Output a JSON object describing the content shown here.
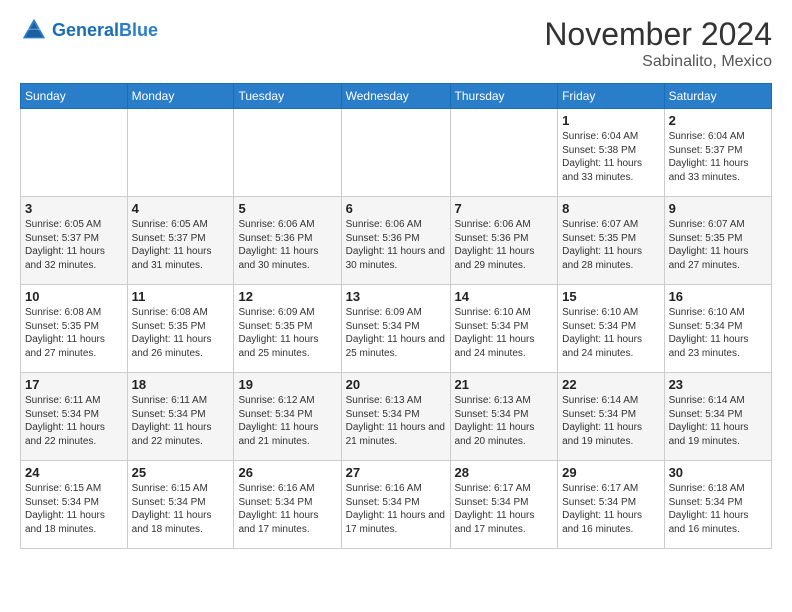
{
  "header": {
    "logo_general": "General",
    "logo_blue": "Blue",
    "title": "November 2024",
    "subtitle": "Sabinalito, Mexico"
  },
  "days_of_week": [
    "Sunday",
    "Monday",
    "Tuesday",
    "Wednesday",
    "Thursday",
    "Friday",
    "Saturday"
  ],
  "weeks": [
    [
      {
        "day": "",
        "info": ""
      },
      {
        "day": "",
        "info": ""
      },
      {
        "day": "",
        "info": ""
      },
      {
        "day": "",
        "info": ""
      },
      {
        "day": "",
        "info": ""
      },
      {
        "day": "1",
        "info": "Sunrise: 6:04 AM\nSunset: 5:38 PM\nDaylight: 11 hours and 33 minutes."
      },
      {
        "day": "2",
        "info": "Sunrise: 6:04 AM\nSunset: 5:37 PM\nDaylight: 11 hours and 33 minutes."
      }
    ],
    [
      {
        "day": "3",
        "info": "Sunrise: 6:05 AM\nSunset: 5:37 PM\nDaylight: 11 hours and 32 minutes."
      },
      {
        "day": "4",
        "info": "Sunrise: 6:05 AM\nSunset: 5:37 PM\nDaylight: 11 hours and 31 minutes."
      },
      {
        "day": "5",
        "info": "Sunrise: 6:06 AM\nSunset: 5:36 PM\nDaylight: 11 hours and 30 minutes."
      },
      {
        "day": "6",
        "info": "Sunrise: 6:06 AM\nSunset: 5:36 PM\nDaylight: 11 hours and 30 minutes."
      },
      {
        "day": "7",
        "info": "Sunrise: 6:06 AM\nSunset: 5:36 PM\nDaylight: 11 hours and 29 minutes."
      },
      {
        "day": "8",
        "info": "Sunrise: 6:07 AM\nSunset: 5:35 PM\nDaylight: 11 hours and 28 minutes."
      },
      {
        "day": "9",
        "info": "Sunrise: 6:07 AM\nSunset: 5:35 PM\nDaylight: 11 hours and 27 minutes."
      }
    ],
    [
      {
        "day": "10",
        "info": "Sunrise: 6:08 AM\nSunset: 5:35 PM\nDaylight: 11 hours and 27 minutes."
      },
      {
        "day": "11",
        "info": "Sunrise: 6:08 AM\nSunset: 5:35 PM\nDaylight: 11 hours and 26 minutes."
      },
      {
        "day": "12",
        "info": "Sunrise: 6:09 AM\nSunset: 5:35 PM\nDaylight: 11 hours and 25 minutes."
      },
      {
        "day": "13",
        "info": "Sunrise: 6:09 AM\nSunset: 5:34 PM\nDaylight: 11 hours and 25 minutes."
      },
      {
        "day": "14",
        "info": "Sunrise: 6:10 AM\nSunset: 5:34 PM\nDaylight: 11 hours and 24 minutes."
      },
      {
        "day": "15",
        "info": "Sunrise: 6:10 AM\nSunset: 5:34 PM\nDaylight: 11 hours and 24 minutes."
      },
      {
        "day": "16",
        "info": "Sunrise: 6:10 AM\nSunset: 5:34 PM\nDaylight: 11 hours and 23 minutes."
      }
    ],
    [
      {
        "day": "17",
        "info": "Sunrise: 6:11 AM\nSunset: 5:34 PM\nDaylight: 11 hours and 22 minutes."
      },
      {
        "day": "18",
        "info": "Sunrise: 6:11 AM\nSunset: 5:34 PM\nDaylight: 11 hours and 22 minutes."
      },
      {
        "day": "19",
        "info": "Sunrise: 6:12 AM\nSunset: 5:34 PM\nDaylight: 11 hours and 21 minutes."
      },
      {
        "day": "20",
        "info": "Sunrise: 6:13 AM\nSunset: 5:34 PM\nDaylight: 11 hours and 21 minutes."
      },
      {
        "day": "21",
        "info": "Sunrise: 6:13 AM\nSunset: 5:34 PM\nDaylight: 11 hours and 20 minutes."
      },
      {
        "day": "22",
        "info": "Sunrise: 6:14 AM\nSunset: 5:34 PM\nDaylight: 11 hours and 19 minutes."
      },
      {
        "day": "23",
        "info": "Sunrise: 6:14 AM\nSunset: 5:34 PM\nDaylight: 11 hours and 19 minutes."
      }
    ],
    [
      {
        "day": "24",
        "info": "Sunrise: 6:15 AM\nSunset: 5:34 PM\nDaylight: 11 hours and 18 minutes."
      },
      {
        "day": "25",
        "info": "Sunrise: 6:15 AM\nSunset: 5:34 PM\nDaylight: 11 hours and 18 minutes."
      },
      {
        "day": "26",
        "info": "Sunrise: 6:16 AM\nSunset: 5:34 PM\nDaylight: 11 hours and 17 minutes."
      },
      {
        "day": "27",
        "info": "Sunrise: 6:16 AM\nSunset: 5:34 PM\nDaylight: 11 hours and 17 minutes."
      },
      {
        "day": "28",
        "info": "Sunrise: 6:17 AM\nSunset: 5:34 PM\nDaylight: 11 hours and 17 minutes."
      },
      {
        "day": "29",
        "info": "Sunrise: 6:17 AM\nSunset: 5:34 PM\nDaylight: 11 hours and 16 minutes."
      },
      {
        "day": "30",
        "info": "Sunrise: 6:18 AM\nSunset: 5:34 PM\nDaylight: 11 hours and 16 minutes."
      }
    ]
  ]
}
